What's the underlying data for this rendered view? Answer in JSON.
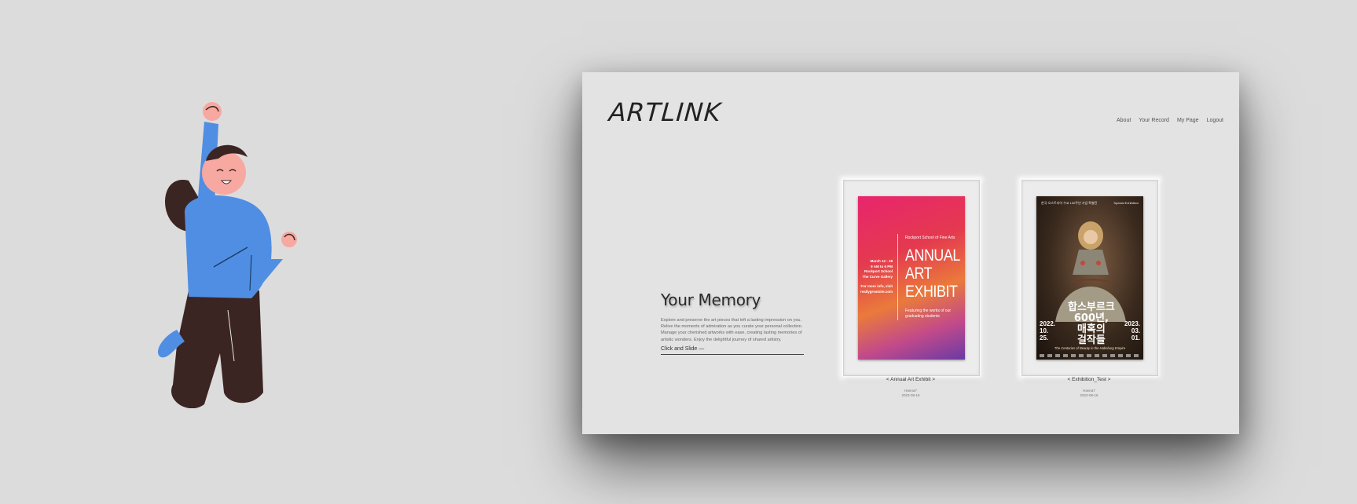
{
  "app": {
    "logo": "ARTLINK",
    "nav": [
      "About",
      "Your Record",
      "My Page",
      "Logout"
    ]
  },
  "intro": {
    "heading": "Your Memory",
    "body": "Explore and preserve the art pieces that left a lasting impression on you. Relive the moments of admiration as you curate your personal collection. Manage your cherished artworks with ease, creating lasting memories of artistic wonders. Enjoy the delightful journey of shared artistry.",
    "cta": "Click and Slide —"
  },
  "cards": [
    {
      "title": "< Annual Art Exhibit >",
      "user": "Hanna7",
      "date": "2023-08-16",
      "poster": {
        "school": "Rockport School of Fine Arts",
        "dates_lines": [
          "March 12 - 18",
          "9 AM to 6 PM",
          "Rockport School",
          "The Curve Gallery"
        ],
        "contact_lines": [
          "For more info, visit",
          "reallygreatsite.com"
        ],
        "title_lines": [
          "ANNUAL",
          "ART",
          "EXHIBIT"
        ],
        "subtitle": "Featuring the works of our graduating students"
      }
    },
    {
      "title": "< Exhibition_Test >",
      "user": "Hanna7",
      "date": "2023-08-16",
      "poster": {
        "top_left": "한국·오스트리아 수교 130주년 기념 특별전",
        "top_right": "Special Exhibition",
        "korean_lines": [
          "합스부르크",
          "600년,",
          "매혹의",
          "걸작들"
        ],
        "year_left": [
          "2022.",
          "10.",
          "25."
        ],
        "year_right": [
          "2023.",
          "03.",
          "01."
        ],
        "english": "The Centuries of Beauty in the Habsburg Empire"
      }
    }
  ]
}
